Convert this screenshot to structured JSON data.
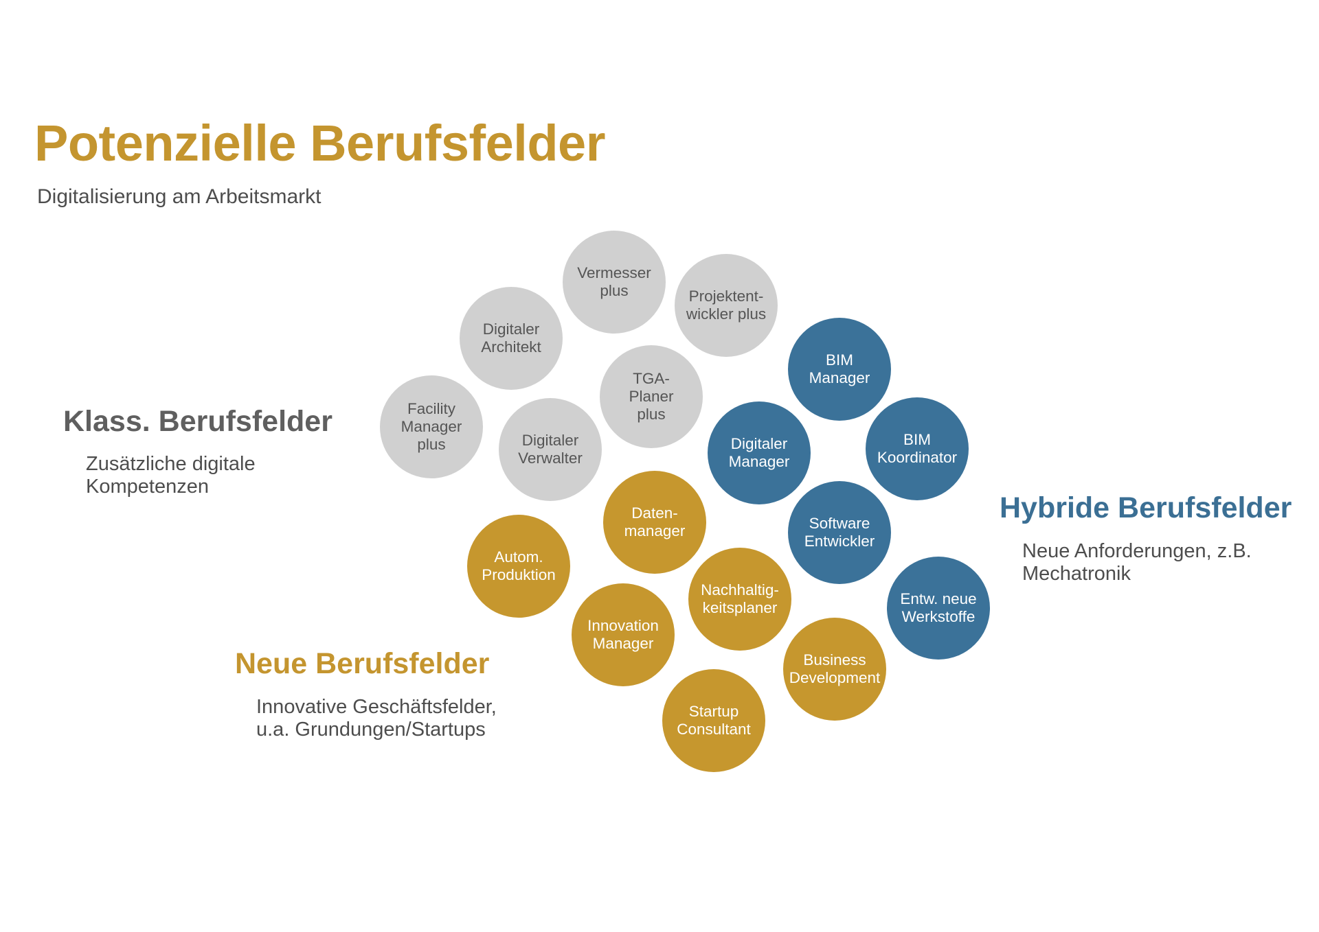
{
  "header": {
    "title": "Potenzielle Berufsfelder",
    "subtitle": "Digitalisierung am Arbeitsmarkt"
  },
  "colors": {
    "gold": "#c6972e",
    "blue": "#3b7299",
    "grey": "#d0d0d0"
  },
  "groups": {
    "klass": {
      "heading": "Klass. Berufsfelder",
      "description": "Zusätzliche digitale Kompetenzen"
    },
    "hybrid": {
      "heading": "Hybride Berufsfelder",
      "description": "Neue Anforderungen, z.B. Mechatronik"
    },
    "neue": {
      "heading": "Neue Berufsfelder",
      "description": "Innovative Geschäftsfelder, u.a. Grundungen/Startups"
    }
  },
  "bubbles": {
    "vermesser_plus": "Vermesser\nplus",
    "projektentwickler_plus": "Projektent-\nwickler plus",
    "digitaler_architekt": "Digitaler\nArchitekt",
    "tga_planer_plus": "TGA-\nPlaner\nplus",
    "facility_manager_plus": "Facility\nManager\nplus",
    "digitaler_verwalter": "Digitaler\nVerwalter",
    "bim_manager": "BIM\nManager",
    "digitaler_manager": "Digitaler\nManager",
    "bim_koordinator": "BIM\nKoordinator",
    "software_entwickler": "Software\nEntwickler",
    "entw_neue_werkstoffe": "Entw. neue\nWerkstoffe",
    "datenmanager": "Daten-\nmanager",
    "autom_produktion": "Autom.\nProduktion",
    "nachhaltigkeitsplaner": "Nachhaltig-\nkeitsplaner",
    "innovation_manager": "Innovation\nManager",
    "business_development": "Business\nDevelopment",
    "startup_consultant": "Startup\nConsultant"
  }
}
